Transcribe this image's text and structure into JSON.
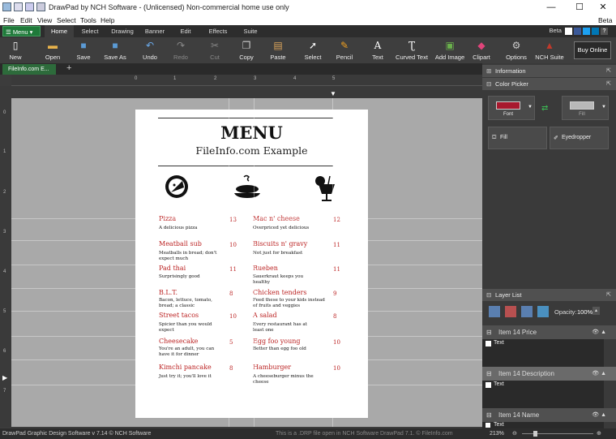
{
  "window": {
    "title": "DrawPad by NCH Software - (Unlicensed) Non-commercial home use only",
    "minimize": "—",
    "maximize": "☐",
    "close": "✕"
  },
  "menubar": {
    "items": [
      "File",
      "Edit",
      "View",
      "Select",
      "Tools",
      "Help"
    ],
    "beta": "Beta"
  },
  "ribbon_tabs": {
    "menu_button": "Menu",
    "tabs": [
      "Home",
      "Select",
      "Drawing",
      "Banner",
      "Edit",
      "Effects",
      "Suite"
    ],
    "beta": "Beta"
  },
  "toolbar": {
    "new": "New",
    "open": "Open",
    "save": "Save",
    "save_as": "Save As",
    "undo": "Undo",
    "redo": "Redo",
    "cut": "Cut",
    "copy": "Copy",
    "paste": "Paste",
    "select": "Select",
    "pencil": "Pencil",
    "text": "Text",
    "curved_text": "Curved Text",
    "add_image": "Add Image",
    "clipart": "Clipart",
    "options": "Options",
    "nch_suite": "NCH Suite",
    "buy_online": "Buy Online"
  },
  "document_tab": {
    "label": "FileInfo.com E...",
    "add": "+"
  },
  "ruler": {
    "h_labels": [
      "0",
      "1",
      "2",
      "3",
      "4",
      "5"
    ],
    "v_labels": [
      "0",
      "1",
      "2",
      "3",
      "4",
      "5",
      "6",
      "7"
    ]
  },
  "menu_page": {
    "title": "MENU",
    "subtitle": "FileInfo.com Example",
    "items_left": [
      {
        "name": "Pizza",
        "price": "13",
        "desc": "A delicious pizza"
      },
      {
        "name": "Meatball sub",
        "price": "10",
        "desc": "Meatballs in bread; don't expect much"
      },
      {
        "name": "Pad thai",
        "price": "11",
        "desc": "Surprisingly good"
      },
      {
        "name": "B.L.T.",
        "price": "8",
        "desc": "Bacon, lettuce, tomato, bread; a classic"
      },
      {
        "name": "Street tacos",
        "price": "10",
        "desc": "Spicier than you would expect"
      },
      {
        "name": "Cheesecake",
        "price": "5",
        "desc": "You're an adult, you can have it for dinner"
      },
      {
        "name": "Kimchi pancake",
        "price": "8",
        "desc": "Just try it; you'll love it"
      }
    ],
    "items_right": [
      {
        "name": "Mac n' cheese",
        "price": "12",
        "desc": "Overpriced yet delicious"
      },
      {
        "name": "Biscuits n' gravy",
        "price": "11",
        "desc": "Not just for breakfast"
      },
      {
        "name": "Rueben",
        "price": "11",
        "desc": "Sauerkraut keeps you healthy"
      },
      {
        "name": "Chicken tenders",
        "price": "9",
        "desc": "Feed these to your kids instead of fruits and veggies"
      },
      {
        "name": "A salad",
        "price": "8",
        "desc": "Every restaurant has at least one"
      },
      {
        "name": "Egg foo young",
        "price": "10",
        "desc": "Better than egg foo old"
      },
      {
        "name": "Hamburger",
        "price": "10",
        "desc": "A cheeseburger minus the cheese"
      }
    ]
  },
  "right_panel": {
    "information": "Information",
    "color_picker": "Color Picker",
    "font_label": "Font",
    "fill_label": "Fill",
    "fill_button": "Fill",
    "eyedropper_button": "Eyedropper",
    "font_color": "#a8192e",
    "fill_color": "#b8b8b8",
    "layer_list": "Layer List",
    "opacity_label": "Opacity:",
    "opacity_value": "100%",
    "layers": [
      {
        "name": "Item 14 Price",
        "sub": "Text"
      },
      {
        "name": "Item 14 Description",
        "sub": "Text"
      },
      {
        "name": "Item 14 Name",
        "sub": "Text"
      }
    ]
  },
  "statusbar": {
    "left": "DrawPad Graphic Design Software v 7.14 © NCH Software",
    "center": "This is a .DRP file open in NCH Software DrawPad 7.1. © FileInfo.com",
    "zoom": "213%"
  }
}
